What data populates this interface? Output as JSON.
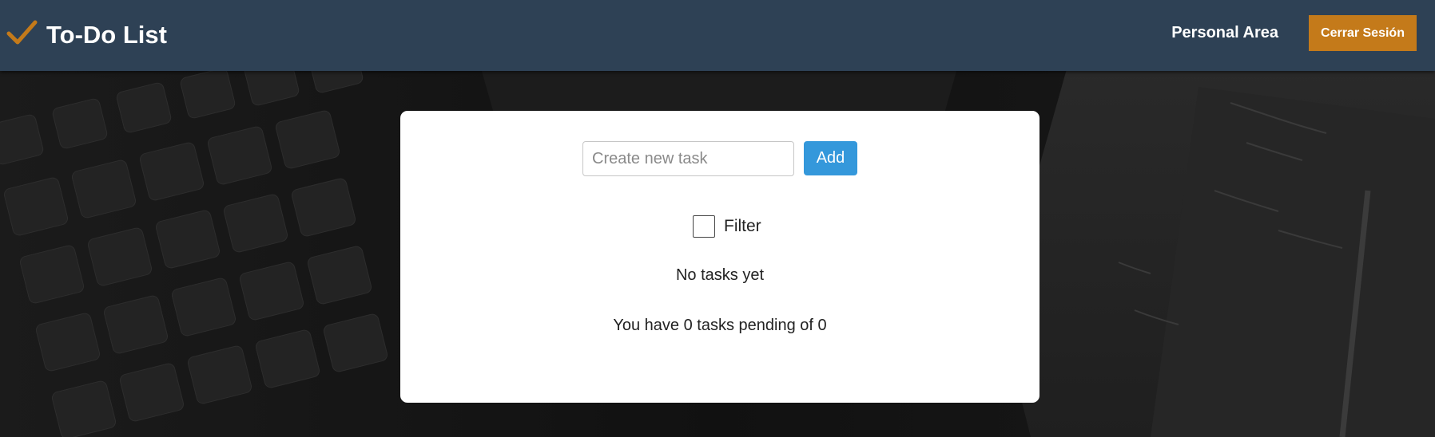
{
  "header": {
    "title": "To-Do List",
    "brand_icon": "checkmark-icon",
    "nav_link": "Personal Area",
    "logout_label": "Cerrar Sesión"
  },
  "task_form": {
    "placeholder": "Create new task",
    "value": "",
    "add_label": "Add"
  },
  "filter": {
    "label": "Filter",
    "checked": false
  },
  "tasks": {
    "items": [],
    "empty_message": "No tasks yet",
    "summary": "You have 0 tasks pending of 0",
    "pending_count": 0,
    "total_count": 0
  },
  "colors": {
    "header_bg": "#2e4155",
    "accent": "#c47a1a",
    "add_button": "#3498db",
    "card_bg": "#ffffff"
  }
}
